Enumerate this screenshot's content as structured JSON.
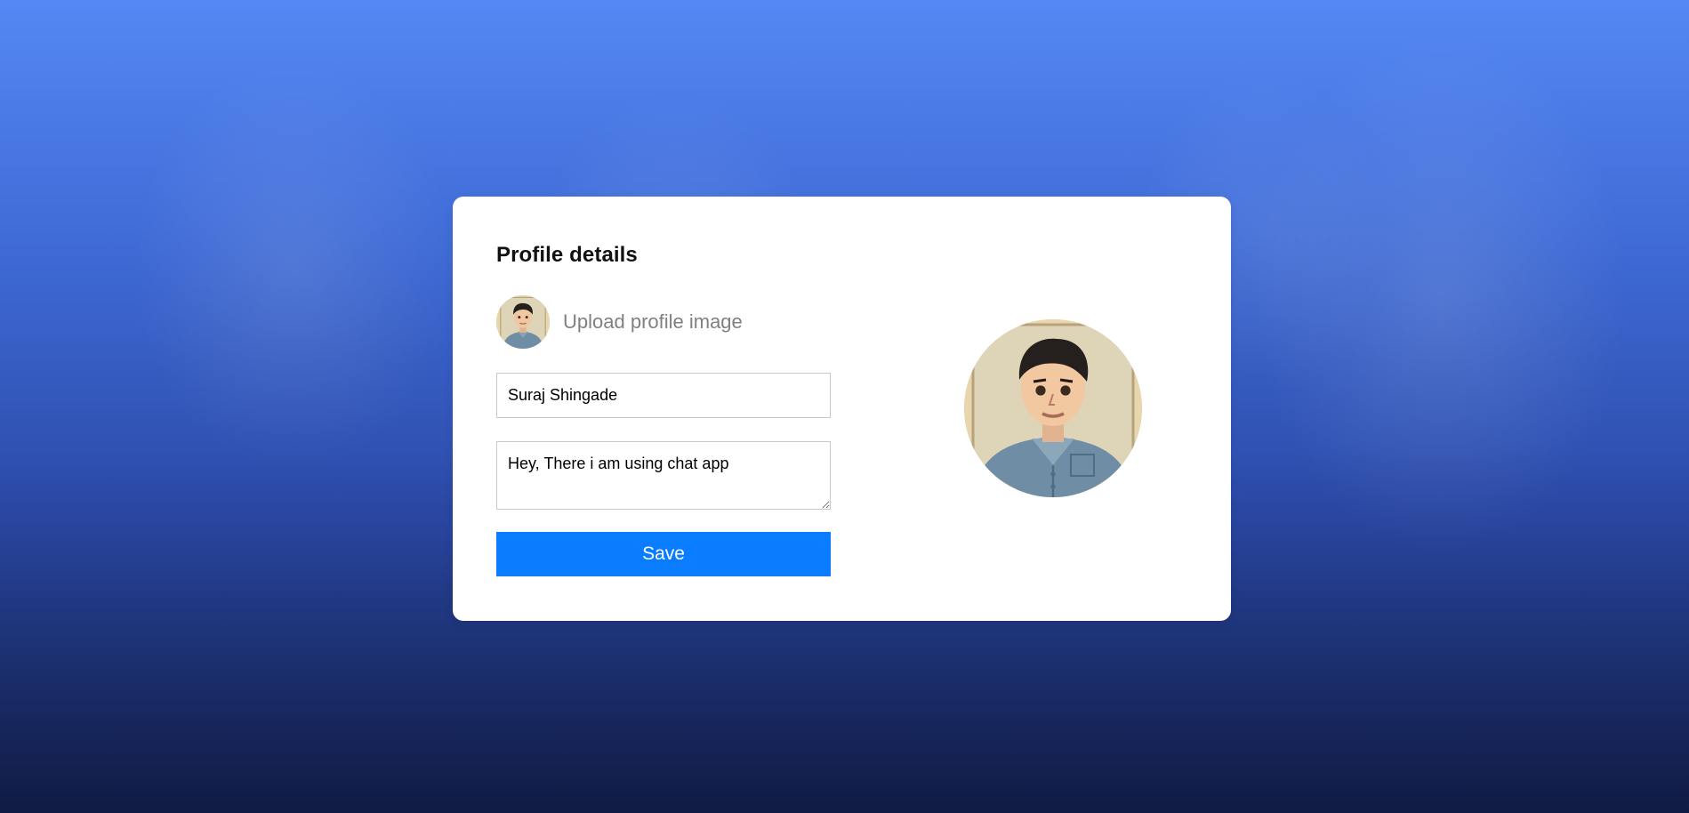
{
  "profile": {
    "title": "Profile details",
    "upload_label": "Upload profile image",
    "name_value": "Suraj Shingade",
    "about_value": "Hey, There i am using chat app",
    "save_label": "Save",
    "avatar_icon": "avatar-illustration"
  },
  "colors": {
    "background_gradient_top": "#5588f4",
    "background_gradient_bottom": "#15245a",
    "card": "#ffffff",
    "primary_button": "#0a7cff",
    "upload_label_text": "#808080",
    "input_border": "#c8c8c8"
  }
}
